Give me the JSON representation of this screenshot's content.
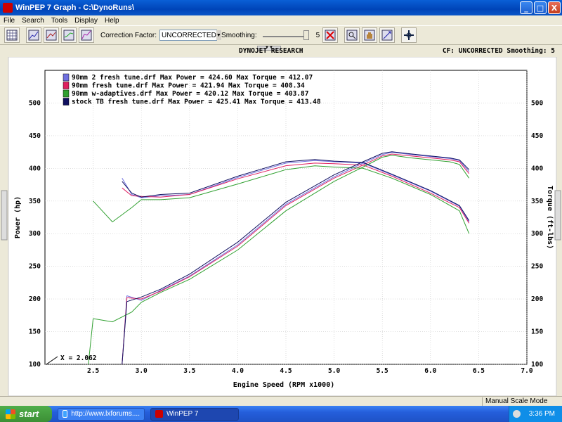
{
  "window": {
    "title": "WinPEP 7    Graph - C:\\DynoRuns\\",
    "minimize": "_",
    "maximize": "□",
    "close": "X"
  },
  "menu": [
    "File",
    "Search",
    "Tools",
    "Display",
    "Help"
  ],
  "toolbar": {
    "correction_label": "Correction Factor:",
    "correction_value": "UNCORRECTED",
    "smoothing_label": "Smoothing:",
    "smoothing_value": "5"
  },
  "graph_header": {
    "company": "DYNOJET RESEARCH",
    "info": "CF: UNCORRECTED  Smoothing: 5"
  },
  "chart_data": {
    "type": "line",
    "xlabel": "Engine Speed (RPM x1000)",
    "ylabel_left": "Power (hp)",
    "ylabel_right": "Torque (ft-lbs)",
    "xlim": [
      2.0,
      7.0
    ],
    "ylim": [
      100,
      550
    ],
    "x_ticks": [
      "2.5",
      "3.0",
      "3.5",
      "4.0",
      "4.5",
      "5.0",
      "5.5",
      "6.0",
      "6.5",
      "7.0"
    ],
    "y_ticks": [
      "100",
      "150",
      "200",
      "250",
      "300",
      "350",
      "400",
      "450",
      "500"
    ],
    "cursor_readout": "X = 2.062",
    "legend": [
      "90mm 2 fresh tune.drf Max Power = 424.60 Max Torque = 412.07",
      "90mm fresh tune.drf Max Power = 421.94 Max Torque = 408.34",
      "90mm w-adaptives.drf Max Power = 420.12 Max Torque = 403.87",
      "stock TB fresh tune.drf Max Power = 425.41 Max Torque = 413.48"
    ],
    "series": [
      {
        "name": "90mm 2 fresh tune.drf",
        "color": "#7070e0",
        "power": [
          [
            2.85,
            205
          ],
          [
            3.0,
            198
          ],
          [
            3.2,
            213
          ],
          [
            3.5,
            235
          ],
          [
            4.0,
            283
          ],
          [
            4.5,
            345
          ],
          [
            5.0,
            387
          ],
          [
            5.3,
            408
          ],
          [
            5.5,
            421
          ],
          [
            5.6,
            424.6
          ],
          [
            5.8,
            421
          ],
          [
            6.0,
            418
          ],
          [
            6.2,
            415
          ],
          [
            6.3,
            412
          ],
          [
            6.4,
            395
          ]
        ],
        "torque": [
          [
            2.8,
            385
          ],
          [
            2.9,
            360
          ],
          [
            3.0,
            355
          ],
          [
            3.2,
            358
          ],
          [
            3.5,
            360
          ],
          [
            4.0,
            386
          ],
          [
            4.5,
            408
          ],
          [
            4.8,
            412
          ],
          [
            5.0,
            410
          ],
          [
            5.3,
            408
          ],
          [
            5.6,
            390
          ],
          [
            6.0,
            365
          ],
          [
            6.3,
            342
          ],
          [
            6.4,
            318
          ]
        ]
      },
      {
        "name": "90mm fresh tune.drf",
        "color": "#e02060",
        "power": [
          [
            2.85,
            202
          ],
          [
            3.0,
            200
          ],
          [
            3.2,
            212
          ],
          [
            3.5,
            234
          ],
          [
            4.0,
            281
          ],
          [
            4.5,
            343
          ],
          [
            5.0,
            385
          ],
          [
            5.3,
            405
          ],
          [
            5.5,
            419
          ],
          [
            5.6,
            421.9
          ],
          [
            5.8,
            419
          ],
          [
            6.0,
            416
          ],
          [
            6.2,
            413
          ],
          [
            6.3,
            410
          ],
          [
            6.4,
            392
          ]
        ],
        "torque": [
          [
            2.8,
            370
          ],
          [
            2.9,
            358
          ],
          [
            3.0,
            357
          ],
          [
            3.2,
            356
          ],
          [
            3.5,
            360
          ],
          [
            4.0,
            384
          ],
          [
            4.5,
            404
          ],
          [
            4.8,
            408
          ],
          [
            5.0,
            407
          ],
          [
            5.3,
            405
          ],
          [
            5.6,
            388
          ],
          [
            6.0,
            362
          ],
          [
            6.3,
            340
          ],
          [
            6.4,
            316
          ]
        ]
      },
      {
        "name": "90mm w-adaptives.drf",
        "color": "#30a030",
        "power": [
          [
            2.5,
            170
          ],
          [
            2.7,
            165
          ],
          [
            2.9,
            180
          ],
          [
            3.0,
            195
          ],
          [
            3.2,
            210
          ],
          [
            3.5,
            230
          ],
          [
            4.0,
            275
          ],
          [
            4.5,
            335
          ],
          [
            5.0,
            380
          ],
          [
            5.3,
            402
          ],
          [
            5.5,
            417
          ],
          [
            5.6,
            420.1
          ],
          [
            5.8,
            416
          ],
          [
            6.0,
            413
          ],
          [
            6.2,
            410
          ],
          [
            6.3,
            406
          ],
          [
            6.4,
            385
          ]
        ],
        "torque": [
          [
            2.5,
            350
          ],
          [
            2.7,
            318
          ],
          [
            2.9,
            340
          ],
          [
            3.0,
            352
          ],
          [
            3.2,
            352
          ],
          [
            3.5,
            355
          ],
          [
            4.0,
            376
          ],
          [
            4.5,
            398
          ],
          [
            4.8,
            403.9
          ],
          [
            5.0,
            402
          ],
          [
            5.3,
            400
          ],
          [
            5.6,
            385
          ],
          [
            6.0,
            360
          ],
          [
            6.3,
            335
          ],
          [
            6.4,
            300
          ]
        ]
      },
      {
        "name": "stock TB fresh tune.drf",
        "color": "#101060",
        "power": [
          [
            2.85,
            196
          ],
          [
            3.0,
            203
          ],
          [
            3.2,
            215
          ],
          [
            3.5,
            238
          ],
          [
            4.0,
            287
          ],
          [
            4.5,
            348
          ],
          [
            5.0,
            390
          ],
          [
            5.3,
            410
          ],
          [
            5.5,
            423
          ],
          [
            5.6,
            425.4
          ],
          [
            5.8,
            422
          ],
          [
            6.0,
            419
          ],
          [
            6.2,
            416
          ],
          [
            6.3,
            413
          ],
          [
            6.4,
            398
          ]
        ],
        "torque": [
          [
            2.8,
            380
          ],
          [
            2.9,
            362
          ],
          [
            3.0,
            356
          ],
          [
            3.2,
            360
          ],
          [
            3.5,
            362
          ],
          [
            4.0,
            388
          ],
          [
            4.5,
            410
          ],
          [
            4.8,
            413.5
          ],
          [
            5.0,
            411
          ],
          [
            5.3,
            409
          ],
          [
            5.6,
            391
          ],
          [
            6.0,
            366
          ],
          [
            6.3,
            343
          ],
          [
            6.4,
            320
          ]
        ]
      }
    ]
  },
  "statusbar": {
    "mode": "Manual Scale Mode"
  },
  "taskbar": {
    "start": "start",
    "tasks": [
      "http://www.lxforums....",
      "WinPEP 7"
    ],
    "clock": "3:36 PM"
  }
}
